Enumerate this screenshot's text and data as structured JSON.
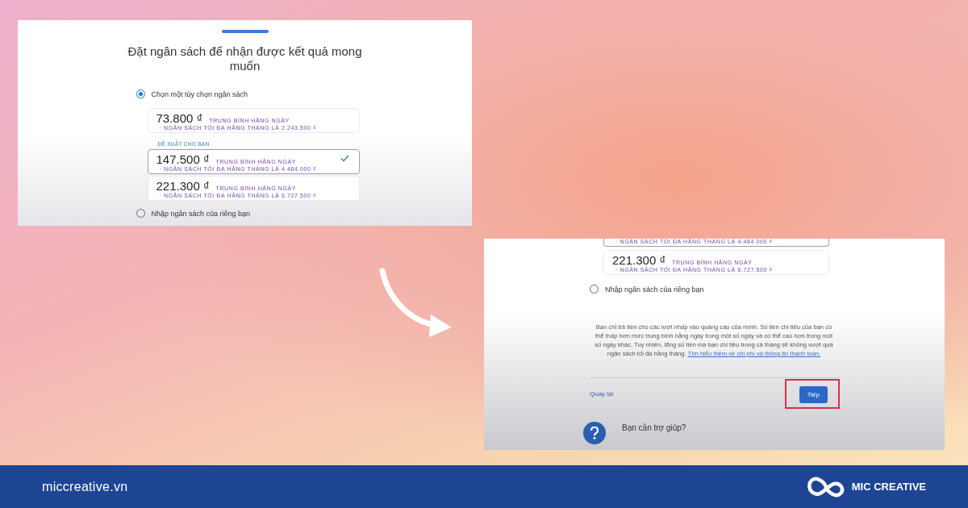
{
  "panel_1": {
    "title": "Đặt ngân sách để nhận được kết quả mong muốn",
    "choices": [
      {
        "label": "Chọn một tùy chọn ngân sách",
        "selected": true
      },
      {
        "label": "Nhập ngân sách của riêng bạn",
        "selected": false
      }
    ],
    "options": [
      {
        "amount": "73.800 ₫",
        "period": "TRUNG BÌNH HẰNG NGÀY",
        "monthly": "· NGÂN SÁCH TỐI ĐA HẰNG THÁNG LÀ 2.243.500 ₫",
        "selected": false
      },
      {
        "badge": "ĐỀ XUẤT CHO BẠN",
        "amount": "147.500 ₫",
        "period": "TRUNG BÌNH HẰNG NGÀY",
        "monthly": "· NGÂN SÁCH TỐI ĐA HẰNG THÁNG LÀ 4.484.000 ₫",
        "selected": true
      },
      {
        "amount": "221.300 ₫",
        "period": "TRUNG BÌNH HẰNG NGÀY",
        "monthly": "· NGÂN SÁCH TỐI ĐA HẰNG THÁNG LÀ 6.727.500 ₫",
        "selected": false
      }
    ]
  },
  "panel_2": {
    "options": [
      {
        "monthly": "· NGÂN SÁCH TỐI ĐA HẰNG THÁNG LÀ 4.484.000 ₫",
        "selected": true
      },
      {
        "amount": "221.300 ₫",
        "period": "TRUNG BÌNH HẰNG NGÀY",
        "monthly": "· NGÂN SÁCH TỐI ĐA HẰNG THÁNG LÀ 6.727.500 ₫",
        "selected": false
      }
    ],
    "choices": [
      {
        "label": "Nhập ngân sách của riêng bạn",
        "selected": false
      }
    ],
    "note": "Bạn chỉ trả tiền cho các lượt nhấp vào quảng cáo của mình. Số tiền chi tiêu của bạn có thể thấp hơn mức trung bình hằng ngày trong một số ngày và có thể cao hơn trong một số ngày khác. Tuy nhiên, tổng số tiền mà bạn chi tiêu trong cả tháng sẽ không vượt quá ngân sách tối đa hằng tháng.",
    "note_link": "Tìm hiểu thêm về chi phí và thông tin thanh toán.",
    "back": "Quay lại",
    "next": "Tiếp",
    "next_highlighted": true,
    "help_title": "Bạn cần trợ giúp?"
  },
  "footer": {
    "site": "miccreative.vn",
    "brand": "MIC CREATIVE"
  }
}
